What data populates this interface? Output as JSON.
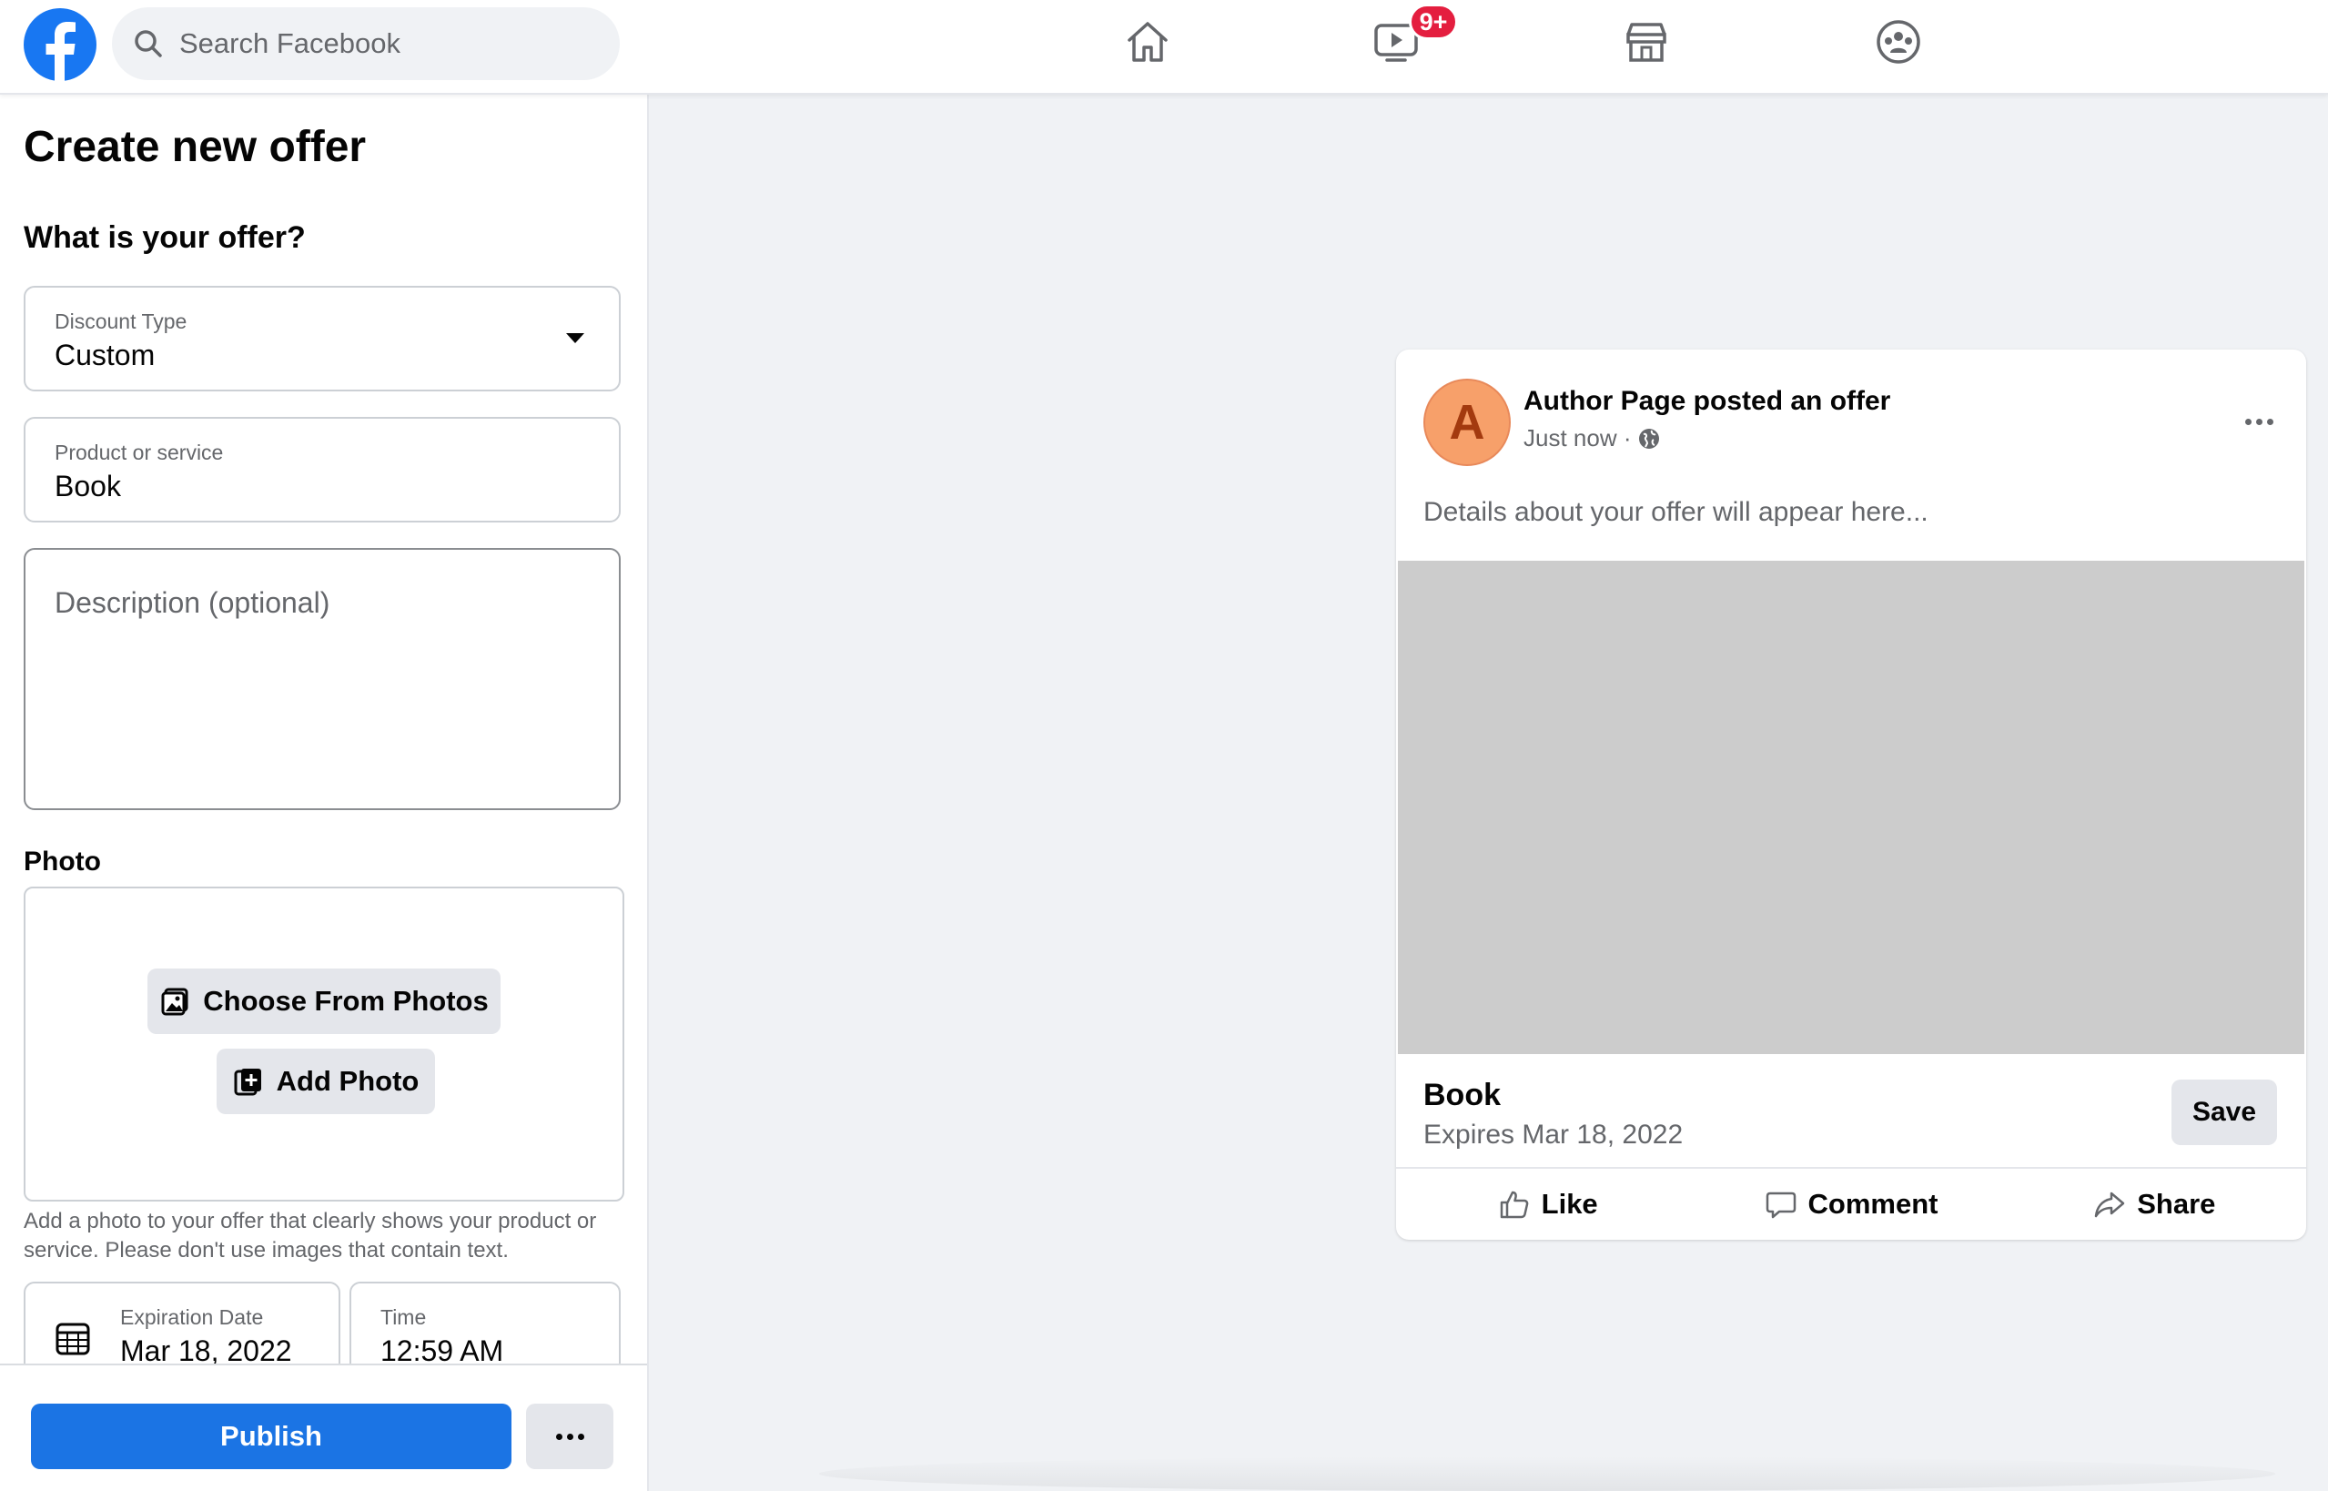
{
  "header": {
    "search_placeholder": "Search Facebook",
    "watch_badge": "9+",
    "nav_icons": [
      "home-icon",
      "watch-icon",
      "marketplace-icon",
      "groups-icon"
    ],
    "brand_color": "#1877f2"
  },
  "form": {
    "title": "Create new offer",
    "section_title": "What is your offer?",
    "discount_type": {
      "label": "Discount Type",
      "value": "Custom"
    },
    "product": {
      "label": "Product or service",
      "value": "Book"
    },
    "description_placeholder": "Description (optional)",
    "photo_label": "Photo",
    "choose_photos_label": "Choose From Photos",
    "add_photo_label": "Add Photo",
    "photo_helper": "Add a photo to your offer that clearly shows your product or service. Please don't use images that contain text.",
    "expiration": {
      "label": "Expiration Date",
      "value": "Mar 18, 2022"
    },
    "time": {
      "label": "Time",
      "value": "12:59 AM"
    },
    "publish_label": "Publish"
  },
  "preview": {
    "avatar_letter": "A",
    "author_line": "Author Page posted an offer",
    "timestamp": "Just now ·",
    "description": "Details about your offer will appear here...",
    "product": "Book",
    "expires": "Expires Mar 18, 2022",
    "save_label": "Save",
    "actions": {
      "like": "Like",
      "comment": "Comment",
      "share": "Share"
    }
  }
}
